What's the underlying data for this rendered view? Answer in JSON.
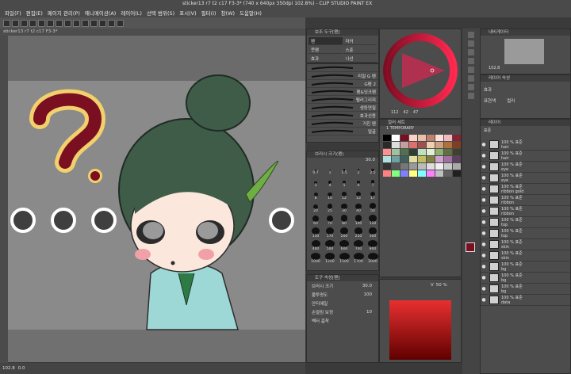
{
  "window": {
    "title": "sticker13 r7 t2 c17 F3-3* (740 x 640px 350dpi 102.8%) - CLIP STUDIO PAINT EX"
  },
  "menu": [
    "파일(F)",
    "편집(E)",
    "페이지 관리(P)",
    "애니메이션(A)",
    "레이어(L)",
    "선택 범위(S)",
    "표시(V)",
    "필터(I)",
    "창(W)",
    "도움말(H)"
  ],
  "doc_tab": "sticker13 r7 t2 c17 F3-3*",
  "status": {
    "zoom": "102.8",
    "coords": "0.0"
  },
  "subtool_tabs": [
    {
      "label": "펜",
      "active": true
    },
    {
      "label": "마커"
    },
    {
      "label": "붓펜"
    },
    {
      "label": "스푼"
    },
    {
      "label": "효과"
    },
    {
      "label": "나선"
    }
  ],
  "subtool_panel_title": "보조 도구[펜]",
  "brushes": [
    {
      "label": ""
    },
    {
      "label": "리얼 G 펜"
    },
    {
      "label": "G펜 2"
    },
    {
      "label": "펜&잉크펜"
    },
    {
      "label": "펠러그리피"
    },
    {
      "label": "생동연필"
    },
    {
      "label": "효과선용"
    },
    {
      "label": "거친 펜"
    },
    {
      "label": "얼굴"
    }
  ],
  "brush_size_panel": {
    "title": "브러시 크기(펜)",
    "value": "30.0"
  },
  "brush_sizes": [
    "0.7",
    "1",
    "1.5",
    "2",
    "2.5",
    "3",
    "4",
    "5",
    "6",
    "7",
    "8",
    "10",
    "12",
    "15",
    "17",
    "20",
    "25",
    "30",
    "40",
    "50",
    "60",
    "70",
    "80",
    "100",
    "120",
    "150",
    "170",
    "200",
    "250",
    "300",
    "400",
    "500",
    "600",
    "700",
    "800",
    "1000",
    "1200",
    "1500",
    "1700",
    "2000"
  ],
  "tool_props": {
    "title": "도구 속성[펜]",
    "rows": [
      {
        "label": "브러시 크기",
        "value": "30.0"
      },
      {
        "label": "불투명도",
        "value": "100"
      },
      {
        "label": "안티에일",
        "value": ""
      },
      {
        "label": "손떨림 보정",
        "value": "10"
      },
      {
        "label": "벡터 흡착",
        "value": ""
      }
    ]
  },
  "colors": {
    "color_set_title": "컬러 세트",
    "color_set_name": "1 TEMPORARY",
    "slider_label": "V",
    "slider_value": "50 %",
    "rgb": [
      "112",
      "42",
      "47"
    ]
  },
  "nav_panel_title": "내비게이터",
  "nav_zoom": "102.8",
  "layer_prop_title": "레이어 속성",
  "effect_label": "효과",
  "expression_label": "표현색",
  "expression_value": "컬러",
  "layer_panel_title": "레이어",
  "blend_mode": "표준",
  "layers": [
    {
      "name": "hair",
      "pct": "100 % 표준"
    },
    {
      "name": "hair",
      "pct": "100 % 표준"
    },
    {
      "name": "eye",
      "pct": "100 % 표준"
    },
    {
      "name": "eye",
      "pct": "100 % 표준"
    },
    {
      "name": "ribbon gold",
      "pct": "100 % 표준"
    },
    {
      "name": "ribbon",
      "pct": "100 % 표준"
    },
    {
      "name": "ribbon",
      "pct": "100 % 표준"
    },
    {
      "name": "top",
      "pct": "100 % 표준"
    },
    {
      "name": "top",
      "pct": "100 % 표준"
    },
    {
      "name": "skin",
      "pct": "100 % 표준"
    },
    {
      "name": "skin",
      "pct": "100 % 표준"
    },
    {
      "name": "bg",
      "pct": "100 % 표준"
    },
    {
      "name": "bg",
      "pct": "100 % 표준"
    },
    {
      "name": "bg",
      "pct": "100 % 표준"
    },
    {
      "name": "data",
      "pct": "100 % 표준"
    }
  ],
  "icons": [
    "eye-icon",
    "folder-icon",
    "pen-icon",
    "eraser-icon",
    "fill-icon",
    "text-icon",
    "move-icon",
    "select-icon"
  ],
  "accent": "#7a0f22"
}
